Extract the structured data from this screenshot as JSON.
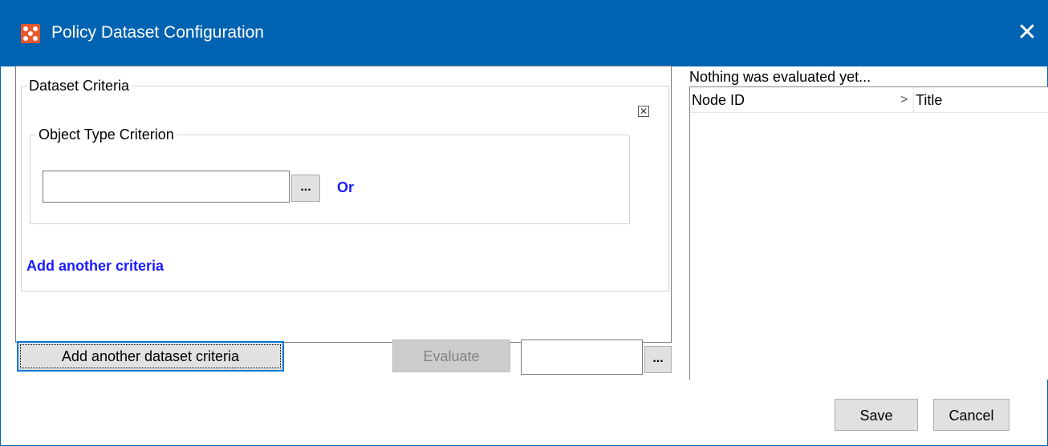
{
  "window": {
    "title": "Policy Dataset Configuration",
    "close_glyph": "✕",
    "accent_color": "#0063b1"
  },
  "dataset": {
    "group_label": "Dataset Criteria",
    "remove_glyph": "☒",
    "object_type": {
      "group_label": "Object Type Criterion",
      "value": "",
      "browse_label": "...",
      "or_label": "Or"
    },
    "add_criteria_label": "Add another criteria"
  },
  "toolbar": {
    "add_dataset_label": "Add another dataset criteria",
    "evaluate_label": "Evaluate",
    "evaluate_value": "",
    "browse_label": "..."
  },
  "results": {
    "status": "Nothing was evaluated yet...",
    "columns": [
      "Node ID",
      "Title"
    ],
    "sort_glyph": ">"
  },
  "footer": {
    "save_label": "Save",
    "cancel_label": "Cancel"
  },
  "colors": {
    "link": "#1a1aff",
    "app_icon": "#e8562b"
  }
}
